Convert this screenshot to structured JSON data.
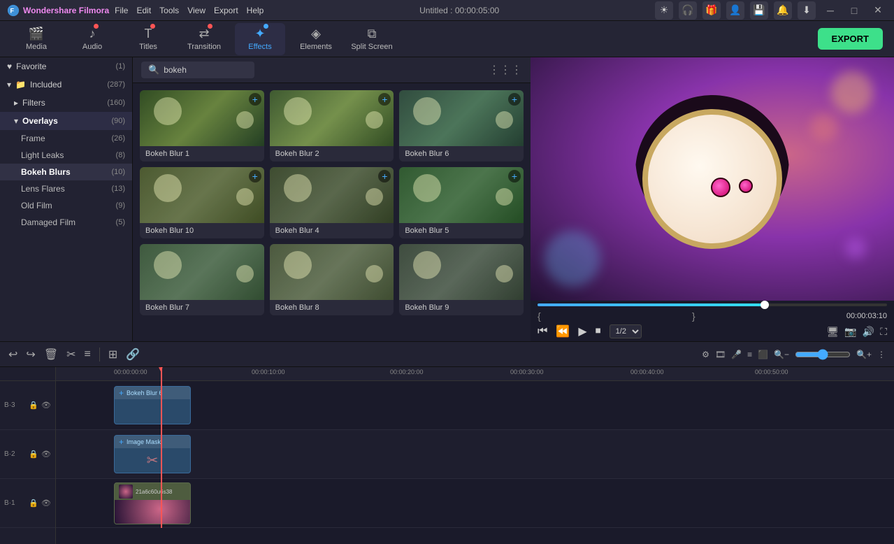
{
  "app": {
    "name": "Wondershare Filmora",
    "title": "Untitled : 00:00:05:00"
  },
  "menu": {
    "items": [
      "File",
      "Edit",
      "Tools",
      "View",
      "Export",
      "Help"
    ]
  },
  "toolbar": {
    "items": [
      {
        "id": "media",
        "label": "Media",
        "icon": "🎬",
        "dot": false,
        "active": false
      },
      {
        "id": "audio",
        "label": "Audio",
        "icon": "🎵",
        "dot": true,
        "dot_color": "red",
        "active": false
      },
      {
        "id": "titles",
        "label": "Titles",
        "icon": "T",
        "dot": true,
        "dot_color": "red",
        "active": false
      },
      {
        "id": "transition",
        "label": "Transition",
        "icon": "⇄",
        "dot": true,
        "dot_color": "red",
        "active": false
      },
      {
        "id": "effects",
        "label": "Effects",
        "icon": "✦",
        "dot": true,
        "dot_color": "blue",
        "active": true
      },
      {
        "id": "elements",
        "label": "Elements",
        "icon": "◈",
        "dot": false,
        "active": false
      },
      {
        "id": "split",
        "label": "Split Screen",
        "icon": "⧉",
        "dot": false,
        "active": false
      }
    ],
    "export_label": "EXPORT"
  },
  "left_panel": {
    "favorite": {
      "label": "Favorite",
      "count": "(1)",
      "icon": "♥"
    },
    "included": {
      "label": "Included",
      "count": "(287)",
      "icon": "📁",
      "expanded": true
    },
    "filters": {
      "label": "Filters",
      "count": "(160)",
      "expanded": false
    },
    "overlays": {
      "label": "Overlays",
      "count": "(90)",
      "active": true,
      "expanded": true
    },
    "sub_items": [
      {
        "label": "Frame",
        "count": "(26)"
      },
      {
        "label": "Light Leaks",
        "count": "(8)"
      },
      {
        "label": "Bokeh Blurs",
        "count": "(10)",
        "active": true
      },
      {
        "label": "Lens Flares",
        "count": "(13)"
      },
      {
        "label": "Old Film",
        "count": "(9)"
      },
      {
        "label": "Damaged Film",
        "count": "(5)"
      }
    ]
  },
  "search": {
    "placeholder": "bokeh",
    "value": "bokeh"
  },
  "effects_grid": {
    "items": [
      {
        "id": "bokeh1",
        "name": "Bokeh Blur 1",
        "thumb_class": "bokeh1"
      },
      {
        "id": "bokeh2",
        "name": "Bokeh Blur 2",
        "thumb_class": "bokeh2"
      },
      {
        "id": "bokeh6",
        "name": "Bokeh Blur 6",
        "thumb_class": "bokeh6"
      },
      {
        "id": "bokeh10",
        "name": "Bokeh Blur 10",
        "thumb_class": "bokeh10"
      },
      {
        "id": "bokeh4",
        "name": "Bokeh Blur 4",
        "thumb_class": "bokeh4"
      },
      {
        "id": "bokeh5",
        "name": "Bokeh Blur 5",
        "thumb_class": "bokeh5"
      },
      {
        "id": "bokeh7",
        "name": "Bokeh Blur 7",
        "thumb_class": "bokeh7"
      },
      {
        "id": "bokeh8",
        "name": "Bokeh Blur 8",
        "thumb_class": "bokeh8"
      },
      {
        "id": "bokeh9",
        "name": "Bokeh Blur 9",
        "thumb_class": "bokeh9"
      }
    ]
  },
  "preview": {
    "time_current": "00:00:03:10",
    "track_label": "1/2",
    "progress_percent": 65
  },
  "timeline": {
    "time_markers": [
      "00:00:00:00",
      "00:00:10:00",
      "00:00:20:00",
      "00:00:30:00",
      "00:00:40:00",
      "00:00:50:00"
    ],
    "tracks": [
      {
        "id": "track3",
        "num": "3",
        "clip_label": "Bokeh Blur 6",
        "type": "overlay"
      },
      {
        "id": "track2",
        "num": "2",
        "clip_label": "Image Mask",
        "type": "overlay"
      },
      {
        "id": "track1",
        "num": "1",
        "clip_label": "21a6c60u6s38",
        "type": "image"
      }
    ]
  }
}
